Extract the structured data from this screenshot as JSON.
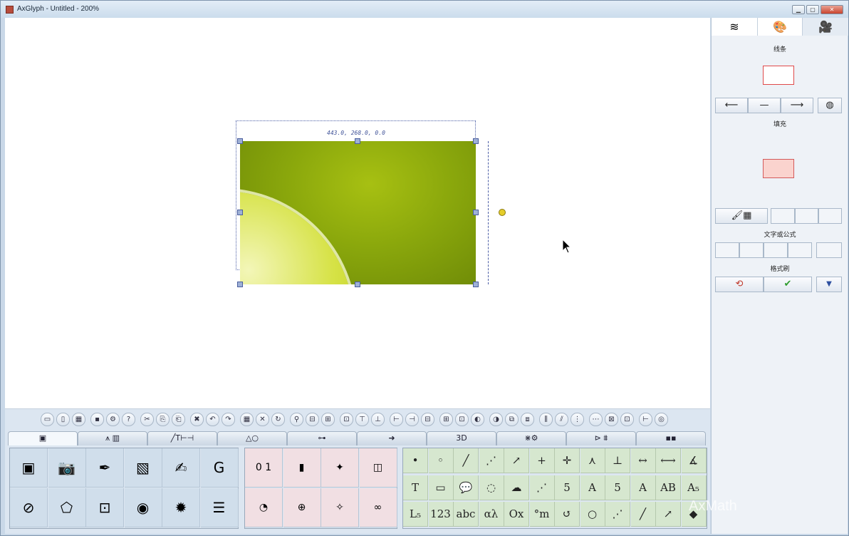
{
  "window": {
    "title": "AxGlyph - Untitled - 200%",
    "min_label": "▁",
    "max_label": "▢",
    "close_label": "✕"
  },
  "canvas": {
    "selection_label": "443.0, 268.0, 0.0"
  },
  "right_panel": {
    "tabs": [
      {
        "icon": "layers-icon",
        "glyph": "≋"
      },
      {
        "icon": "palette-icon",
        "glyph": "🎨"
      },
      {
        "icon": "camera-icon",
        "glyph": "🎥"
      }
    ],
    "line_label": "线条",
    "fill_label": "填充",
    "text_label": "文字或公式",
    "format_brush_label": "格式刷",
    "arrow_left": "⟵",
    "line_dash": "—",
    "arrow_right": "⟶",
    "palette_glyph": "◍",
    "picker_glyph": "🖌▦",
    "swap_glyph": "⟲",
    "check_glyph": "✔",
    "dropdown_glyph": "▼"
  },
  "toolbar": {
    "buttons": [
      "▭",
      "▯",
      "▦",
      "▪",
      "⚙",
      "?",
      "✂",
      "⎘",
      "⎗",
      "✖",
      "↶",
      "↷",
      "▦",
      "✕",
      "↻",
      "⚲",
      "⊟",
      "⊞",
      "⊡",
      "⊤",
      "⊥",
      "⊢",
      "⊣",
      "⊟",
      "⊞",
      "⊡",
      "◐",
      "◑",
      "⧉",
      "⧈",
      "⫼",
      "⫽",
      "⋮",
      "⋯",
      "⊠",
      "⊡",
      "⊢",
      "◎"
    ]
  },
  "ribbon_tabs": [
    "▣",
    "⩚ ▥",
    "╱T⊢⊣",
    "△○",
    "⊶",
    "➜",
    "3D",
    "⋇⚙",
    "⊳ ⩩",
    "▪▪"
  ],
  "gallery_left": [
    "▣",
    "📷",
    "✒",
    "▧",
    "✍",
    "G",
    "⊘",
    "⬠",
    "⊡",
    "◉",
    "✹",
    "☰"
  ],
  "gallery_mid": [
    "0 1",
    "▮",
    "✦",
    "◫",
    "◔",
    "⊕",
    "✧",
    "∞"
  ],
  "gallery_right": [
    "•",
    "◦",
    "╱",
    "⋰",
    "↗",
    "+",
    "✛",
    "⋏",
    "⊥",
    "↔",
    "⟷",
    "∡",
    "T",
    "▭",
    "💬",
    "◌",
    "☁",
    "⋰",
    "5",
    "A",
    "5",
    "A",
    "AB",
    "A₅",
    "L₅",
    "123",
    "abc",
    "αλ",
    "Ox",
    "°m",
    "↺",
    "○",
    "⋰",
    "╱",
    "↗",
    "◆"
  ],
  "watermark": "AxMath"
}
